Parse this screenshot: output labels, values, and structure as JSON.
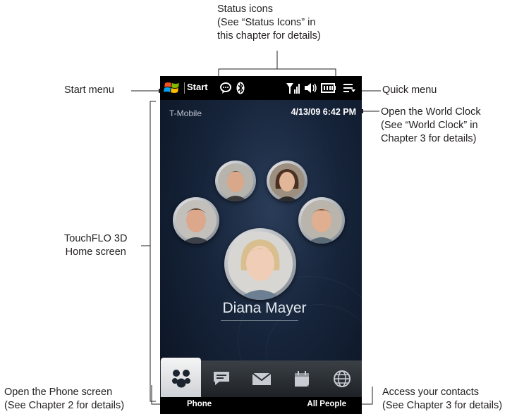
{
  "annotations": {
    "status_icons": [
      "Status icons",
      "(See “Status Icons” in",
      "this chapter for details)"
    ],
    "start_menu": "Start menu",
    "quick_menu": "Quick menu",
    "world_clock": [
      "Open the World Clock",
      "(See “World Clock” in",
      "Chapter 3 for details)"
    ],
    "home_screen": [
      "TouchFLO 3D",
      "Home screen"
    ],
    "phone_screen": [
      "Open the Phone screen",
      "(See Chapter 2 for details)"
    ],
    "contacts": [
      "Access your contacts",
      "(See Chapter 3 for details)"
    ]
  },
  "phone": {
    "status_bar": {
      "start_label": "Start",
      "icons": [
        "windows-logo-icon",
        "message-bubble-icon",
        "bluetooth-icon",
        "signal-icon",
        "speaker-icon",
        "battery-icon",
        "quick-menu-icon"
      ]
    },
    "carrier": "T-Mobile",
    "datetime": "4/13/09 6:42 PM",
    "contact_name": "Diana Mayer",
    "tabs": [
      "people-icon",
      "messaging-icon",
      "email-icon",
      "calendar-icon",
      "internet-icon"
    ],
    "soft_left": "Phone",
    "soft_right": "All People"
  }
}
